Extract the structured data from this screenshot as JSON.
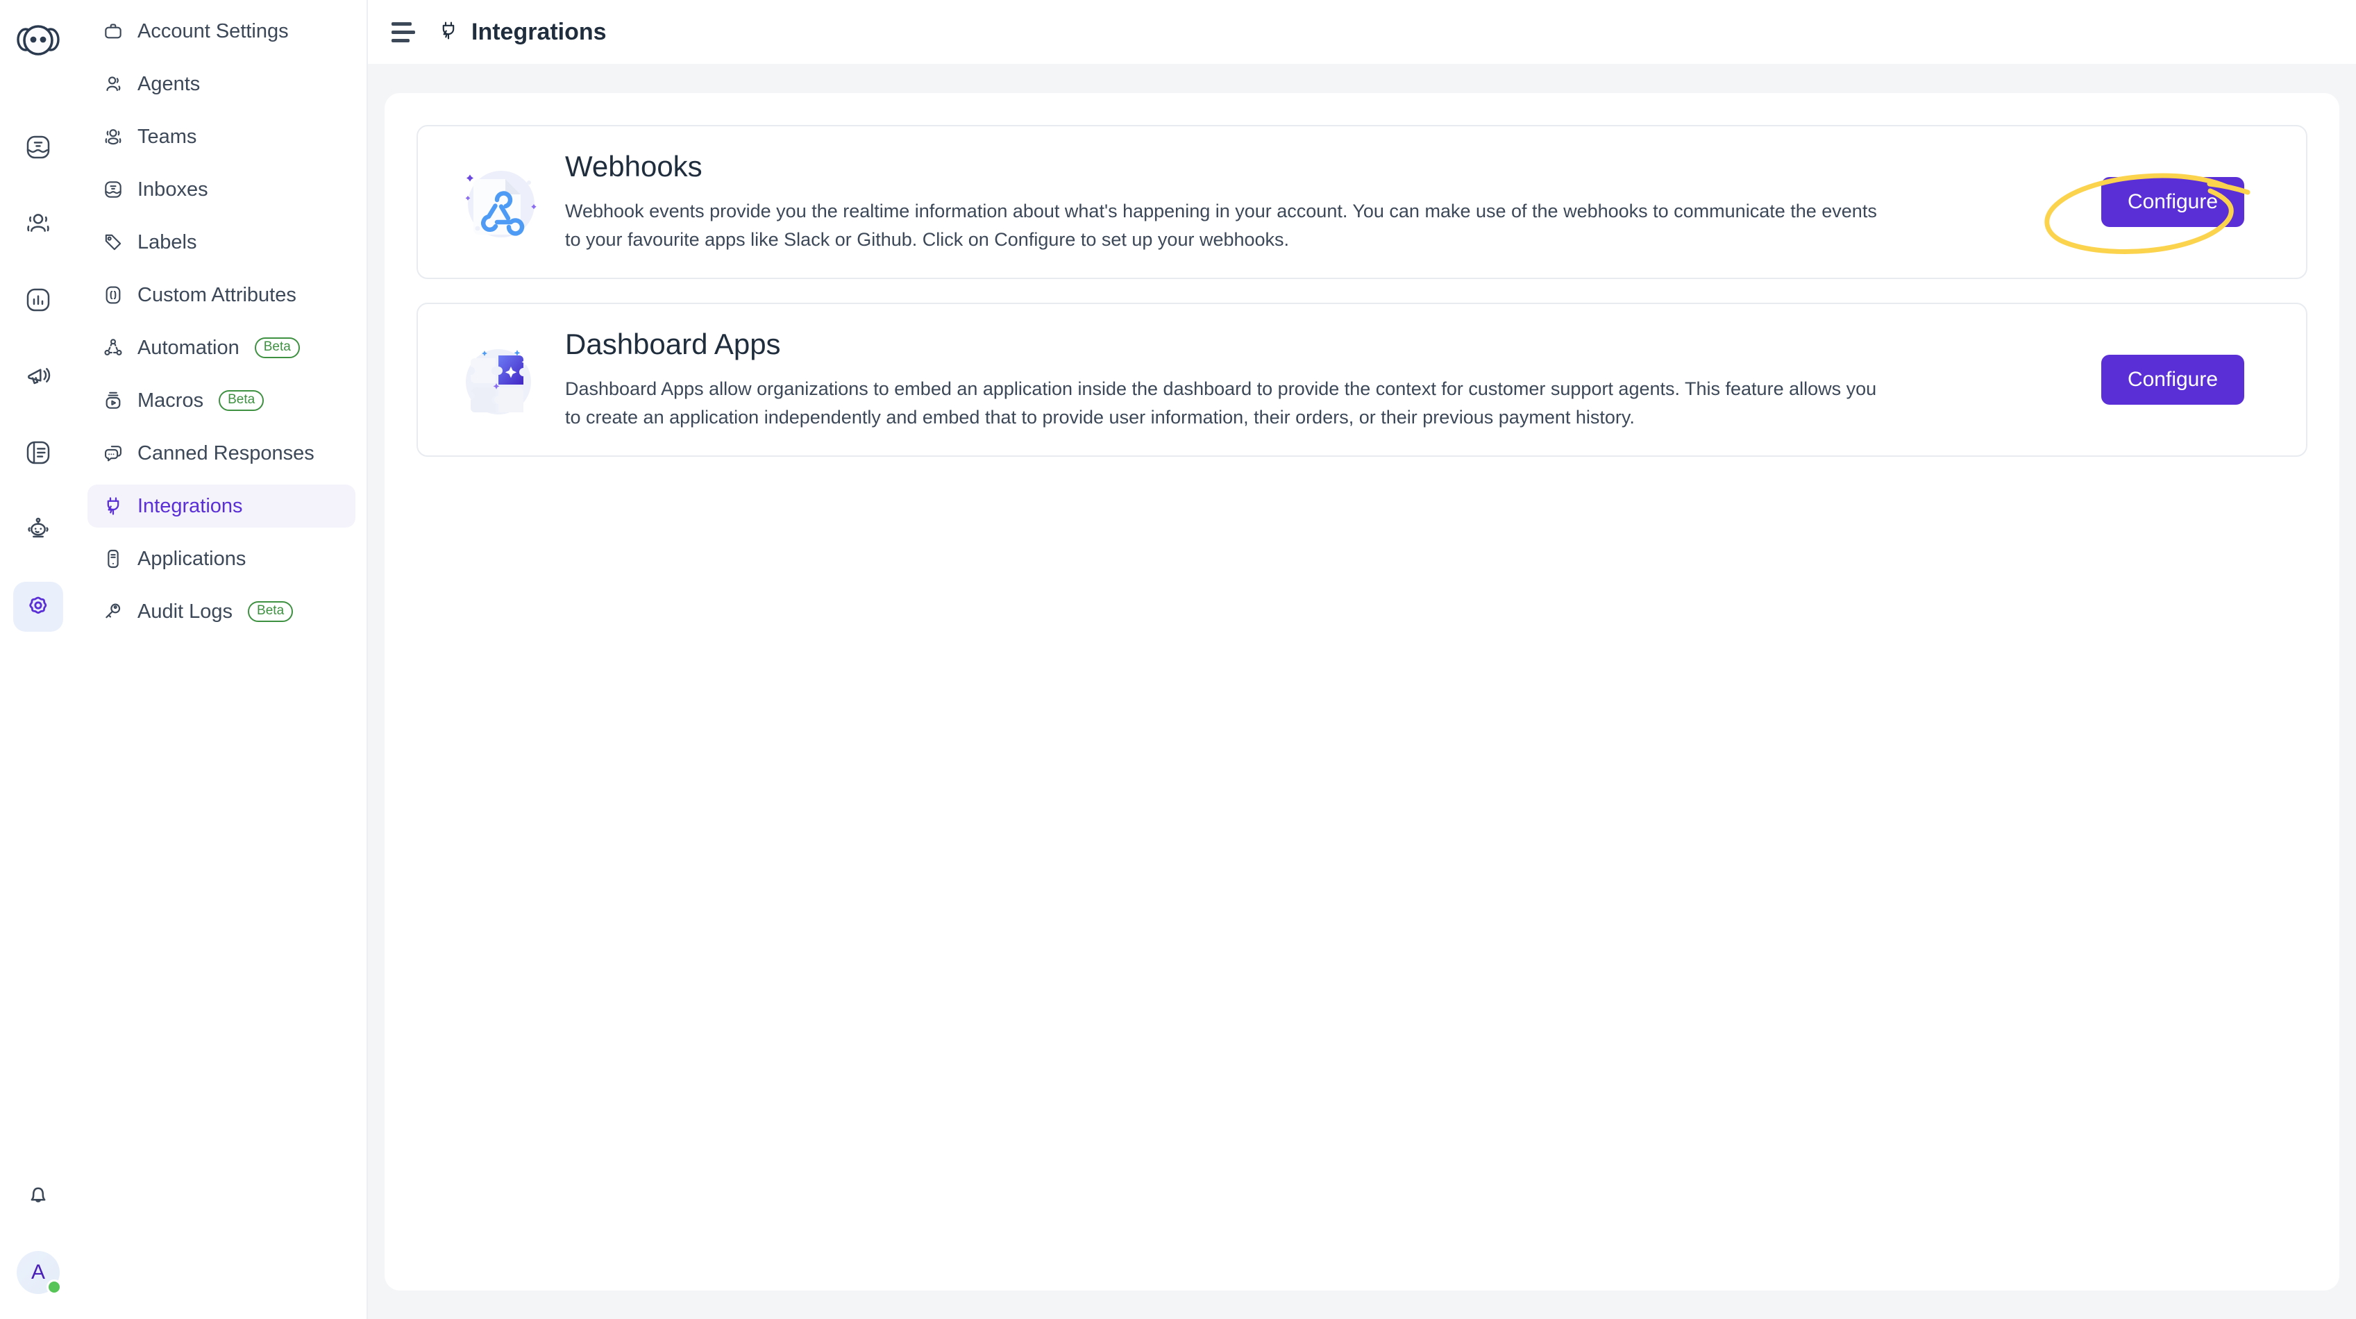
{
  "app": {
    "brand_icon": "chatwoot-logo-icon",
    "accent_color": "#5a2fd6",
    "active_rail_bg": "#e9f0fb",
    "beta_color": "#3f9142",
    "annotation_color": "#fcd34d"
  },
  "rail": {
    "items": [
      {
        "name": "conversations",
        "icon": "inbox-icon"
      },
      {
        "name": "contacts",
        "icon": "contacts-icon"
      },
      {
        "name": "reports",
        "icon": "bar-chart-icon"
      },
      {
        "name": "campaigns",
        "icon": "megaphone-icon"
      },
      {
        "name": "portal",
        "icon": "book-icon"
      },
      {
        "name": "bots",
        "icon": "robot-icon"
      },
      {
        "name": "settings",
        "icon": "gear-icon",
        "active": true
      }
    ],
    "bottom": {
      "notifications_icon": "bell-icon",
      "avatar_initial": "A",
      "status": "online"
    }
  },
  "sidebar": {
    "items": [
      {
        "label": "Account Settings",
        "icon": "briefcase-icon",
        "active": false,
        "beta": null
      },
      {
        "label": "Agents",
        "icon": "agent-icon",
        "active": false,
        "beta": null
      },
      {
        "label": "Teams",
        "icon": "teams-icon",
        "active": false,
        "beta": null
      },
      {
        "label": "Inboxes",
        "icon": "inbox-icon",
        "active": false,
        "beta": null
      },
      {
        "label": "Labels",
        "icon": "tag-icon",
        "active": false,
        "beta": null
      },
      {
        "label": "Custom Attributes",
        "icon": "braces-icon",
        "active": false,
        "beta": null
      },
      {
        "label": "Automation",
        "icon": "automation-icon",
        "active": false,
        "beta": "Beta"
      },
      {
        "label": "Macros",
        "icon": "macros-icon",
        "active": false,
        "beta": "Beta"
      },
      {
        "label": "Canned Responses",
        "icon": "chat-bubbles-icon",
        "active": false,
        "beta": null
      },
      {
        "label": "Integrations",
        "icon": "plug-icon",
        "active": true,
        "beta": null
      },
      {
        "label": "Applications",
        "icon": "application-icon",
        "active": false,
        "beta": null
      },
      {
        "label": "Audit Logs",
        "icon": "key-icon",
        "active": false,
        "beta": "Beta"
      }
    ]
  },
  "topbar": {
    "menu_icon": "hamburger-menu-icon",
    "title_icon": "plug-icon",
    "title": "Integrations"
  },
  "main": {
    "cards": [
      {
        "id": "webhooks",
        "icon": "webhook-document-icon",
        "title": "Webhooks",
        "description": "Webhook events provide you the realtime information about what's happening in your account. You can make use of the webhooks to communicate the events to your favourite apps like Slack or Github. Click on Configure to set up your webhooks.",
        "button_label": "Configure",
        "annotated": true
      },
      {
        "id": "dashboard-apps",
        "icon": "puzzle-pieces-icon",
        "title": "Dashboard Apps",
        "description": "Dashboard Apps allow organizations to embed an application inside the dashboard to provide the context for customer support agents. This feature allows you to create an application independently and embed that to provide user information, their orders, or their previous payment history.",
        "button_label": "Configure",
        "annotated": false
      }
    ]
  }
}
